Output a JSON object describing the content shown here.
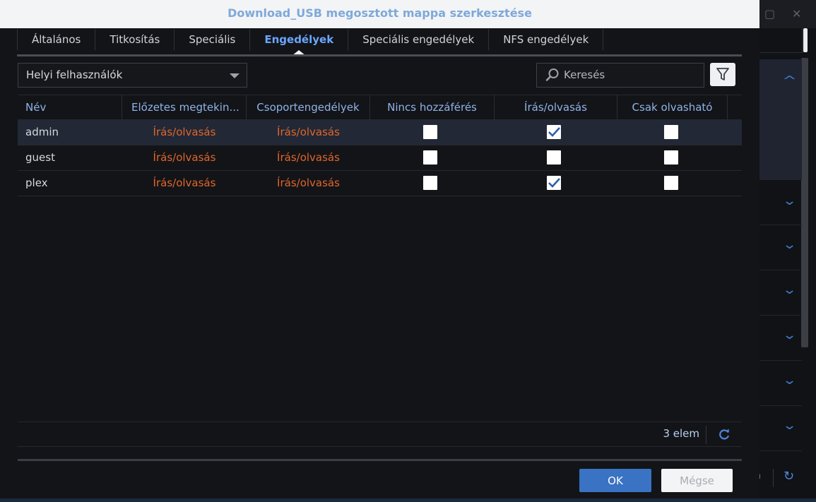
{
  "dialog": {
    "title": "Download_USB megosztott mappa szerkesztése"
  },
  "tabs": [
    {
      "label": "Általános",
      "active": false
    },
    {
      "label": "Titkosítás",
      "active": false
    },
    {
      "label": "Speciális",
      "active": false
    },
    {
      "label": "Engedélyek",
      "active": true
    },
    {
      "label": "Speciális engedélyek",
      "active": false
    },
    {
      "label": "NFS engedélyek",
      "active": false
    }
  ],
  "user_type_select": {
    "value": "Helyi felhasználók"
  },
  "search": {
    "placeholder": "Keresés",
    "icon": "search-icon"
  },
  "filter_button": {
    "icon": "filter-icon"
  },
  "table": {
    "columns": [
      "Név",
      "Előzetes megtekin...",
      "Csoportengedélyek",
      "Nincs hozzáférés",
      "Írás/olvasás",
      "Csak olvasható"
    ],
    "rows": [
      {
        "name": "admin",
        "preview": "Írás/olvasás",
        "group": "Írás/olvasás",
        "no_access": false,
        "read_write": true,
        "read_only": false,
        "selected": true
      },
      {
        "name": "guest",
        "preview": "Írás/olvasás",
        "group": "Írás/olvasás",
        "no_access": false,
        "read_write": false,
        "read_only": false,
        "selected": false
      },
      {
        "name": "plex",
        "preview": "Írás/olvasás",
        "group": "Írás/olvasás",
        "no_access": false,
        "read_write": true,
        "read_only": false,
        "selected": false
      }
    ]
  },
  "footer": {
    "count": "3 elem",
    "refresh_icon": "refresh-icon"
  },
  "buttons": {
    "ok": "OK",
    "cancel": "Mégse"
  },
  "background_window": {
    "footer_text": "n"
  },
  "colors": {
    "accent": "#3a72c4",
    "active_tab": "#6aa6ff",
    "header_text": "#8fb3e8",
    "permission_text": "#e0662a",
    "title_text": "#7fa9d9",
    "background": "#131418"
  }
}
